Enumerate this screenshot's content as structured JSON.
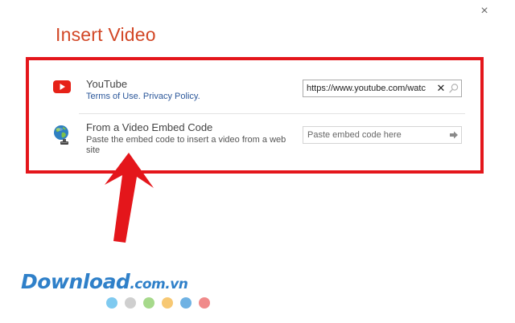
{
  "window": {
    "close_glyph": "×"
  },
  "dialog": {
    "title": "Insert Video"
  },
  "sources": {
    "youtube": {
      "name": "YouTube",
      "terms_link": "Terms of Use.",
      "privacy_link": "Privacy Policy.",
      "search_value": "https://www.youtube.com/watc",
      "clear_glyph": "✕",
      "icon": "youtube-icon"
    },
    "embed": {
      "name": "From a Video Embed Code",
      "description": "Paste the embed code to insert a video from a web site",
      "placeholder": "Paste embed code here",
      "icon": "globe-icon"
    }
  },
  "watermark": {
    "brand": "Download",
    "domain": ".com.vn",
    "dot_colors": [
      "#7fcaf0",
      "#cfcfcf",
      "#a6d98b",
      "#f7c873",
      "#6fb2e3",
      "#f08a8a"
    ]
  },
  "colors": {
    "title": "#d24726",
    "highlight": "#e4161b",
    "link": "#2b579a",
    "youtube_red": "#e62117",
    "watermark": "#2f80c9"
  }
}
